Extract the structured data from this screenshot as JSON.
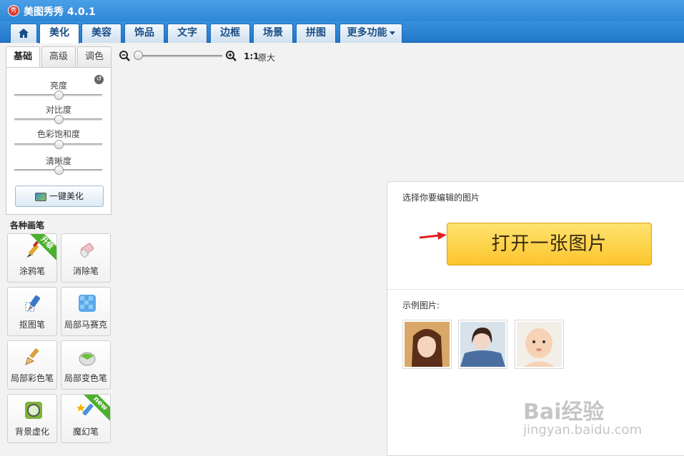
{
  "titlebar": {
    "logo_text": "秀",
    "title": "美图秀秀 4.0.1"
  },
  "nav": {
    "tabs": [
      "美化",
      "美容",
      "饰品",
      "文字",
      "边框",
      "场景",
      "拼图"
    ],
    "more_label": "更多功能"
  },
  "left": {
    "subtabs": [
      "基础",
      "高级",
      "调色"
    ],
    "sliders": [
      {
        "label": "亮度",
        "value": 50
      },
      {
        "label": "对比度",
        "value": 50
      },
      {
        "label": "色彩饱和度",
        "value": 50
      },
      {
        "label": "清晰度",
        "value": 50
      }
    ],
    "auto_button": "一键美化",
    "brush_title": "各种画笔",
    "brushes": [
      {
        "label": "涂鸦笔",
        "badge": "升级",
        "icon": "brush-icon"
      },
      {
        "label": "消除笔",
        "badge": "",
        "icon": "eraser-icon"
      },
      {
        "label": "抠图笔",
        "badge": "",
        "icon": "cutout-pen-icon"
      },
      {
        "label": "局部马赛克",
        "badge": "",
        "icon": "mosaic-icon"
      },
      {
        "label": "局部彩色笔",
        "badge": "",
        "icon": "color-brush-icon"
      },
      {
        "label": "局部变色笔",
        "badge": "",
        "icon": "recolor-icon"
      },
      {
        "label": "背景虚化",
        "badge": "",
        "icon": "blur-icon"
      },
      {
        "label": "魔幻笔",
        "badge": "new",
        "icon": "magic-pen-icon"
      }
    ]
  },
  "zoom": {
    "ratio": "1:1",
    "original": "原大",
    "level": 0
  },
  "open_panel": {
    "select_label": "选择你要编辑的图片",
    "open_button": "打开一张图片",
    "sample_label": "示例图片:"
  },
  "watermark": {
    "logo": "Bai经验",
    "url": "jingyan.baidu.com"
  },
  "colors": {
    "accent": "#2f86d6",
    "button": "#fbc52c",
    "arrow": "#e02020",
    "badge": "#4caf2e"
  }
}
